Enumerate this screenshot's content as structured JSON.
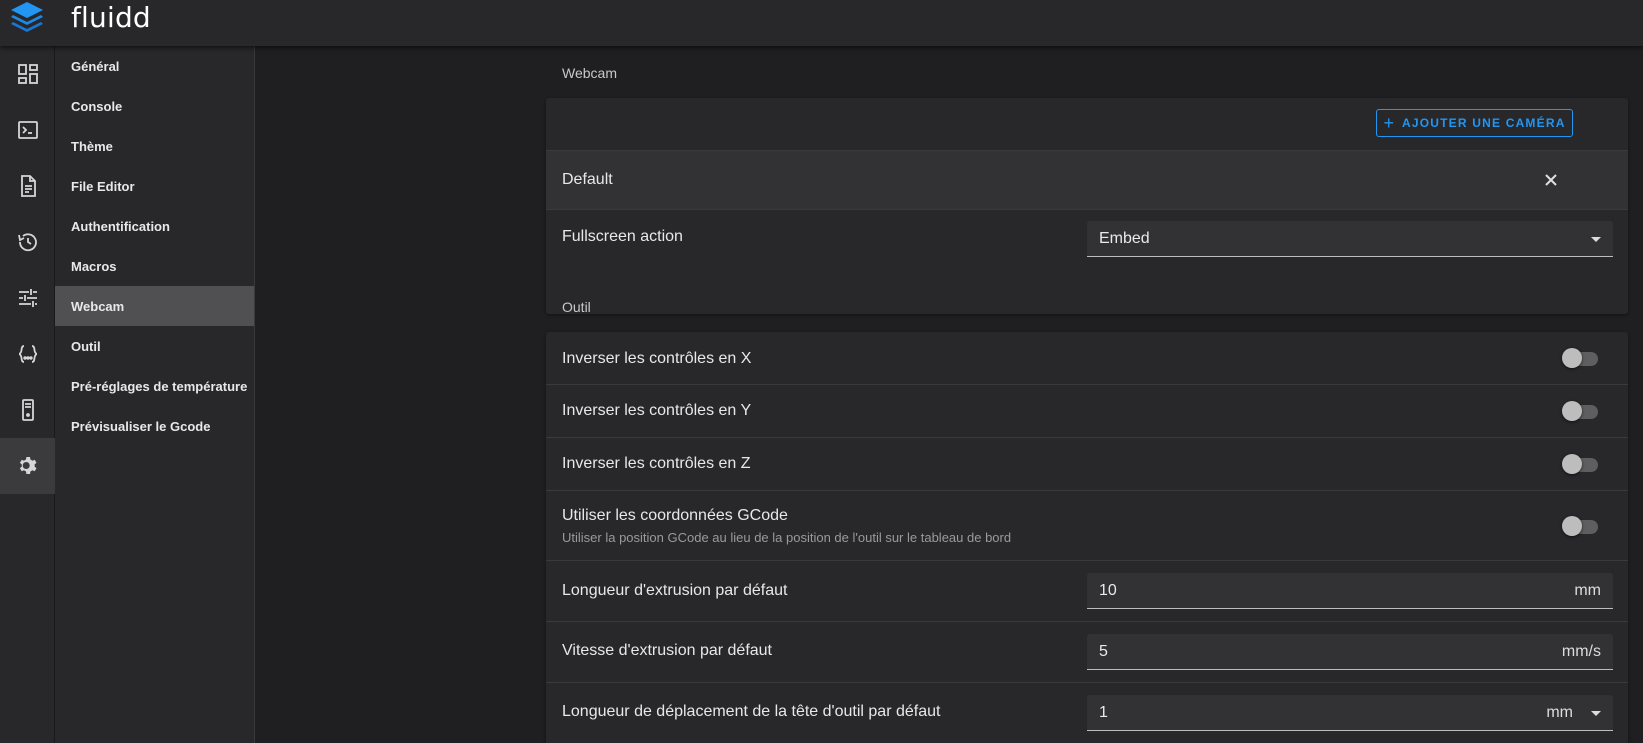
{
  "app": {
    "title": "fluidd"
  },
  "rail": {
    "items": [
      {
        "icon": "dashboard-icon"
      },
      {
        "icon": "console-icon"
      },
      {
        "icon": "file-icon"
      },
      {
        "icon": "history-icon"
      },
      {
        "icon": "tune-icon"
      },
      {
        "icon": "code-braces-icon"
      },
      {
        "icon": "printer-icon"
      },
      {
        "icon": "gear-icon",
        "active": true
      }
    ]
  },
  "settings_nav": {
    "items": [
      {
        "label": "Général"
      },
      {
        "label": "Console"
      },
      {
        "label": "Thème"
      },
      {
        "label": "File Editor"
      },
      {
        "label": "Authentification"
      },
      {
        "label": "Macros"
      },
      {
        "label": "Webcam",
        "active": true
      },
      {
        "label": "Outil"
      },
      {
        "label": "Pré-réglages de température"
      },
      {
        "label": "Prévisualiser le Gcode"
      }
    ]
  },
  "webcam": {
    "section_title": "Webcam",
    "add_button": "AJOUTER UNE CAMÉRA",
    "camera_name": "Default",
    "fullscreen_label": "Fullscreen action",
    "fullscreen_value": "Embed"
  },
  "outil": {
    "section_title": "Outil",
    "invert_x": {
      "label": "Inverser les contrôles en X",
      "on": false
    },
    "invert_y": {
      "label": "Inverser les contrôles en Y",
      "on": false
    },
    "invert_z": {
      "label": "Inverser les contrôles en Z",
      "on": false
    },
    "gcode_coords": {
      "label": "Utiliser les coordonnées GCode",
      "sub": "Utiliser la position GCode au lieu de la position de l'outil sur le tableau de bord",
      "on": false
    },
    "extrude_length": {
      "label": "Longueur d'extrusion par défaut",
      "value": "10",
      "unit": "mm"
    },
    "extrude_speed": {
      "label": "Vitesse d'extrusion par défaut",
      "value": "5",
      "unit": "mm/s"
    },
    "move_distance": {
      "label": "Longueur de déplacement de la tête d'outil par défaut",
      "value": "1",
      "unit": "mm"
    }
  },
  "colors": {
    "accent": "#2196f3",
    "background": "#1f1f21",
    "surface": "#28282b"
  }
}
